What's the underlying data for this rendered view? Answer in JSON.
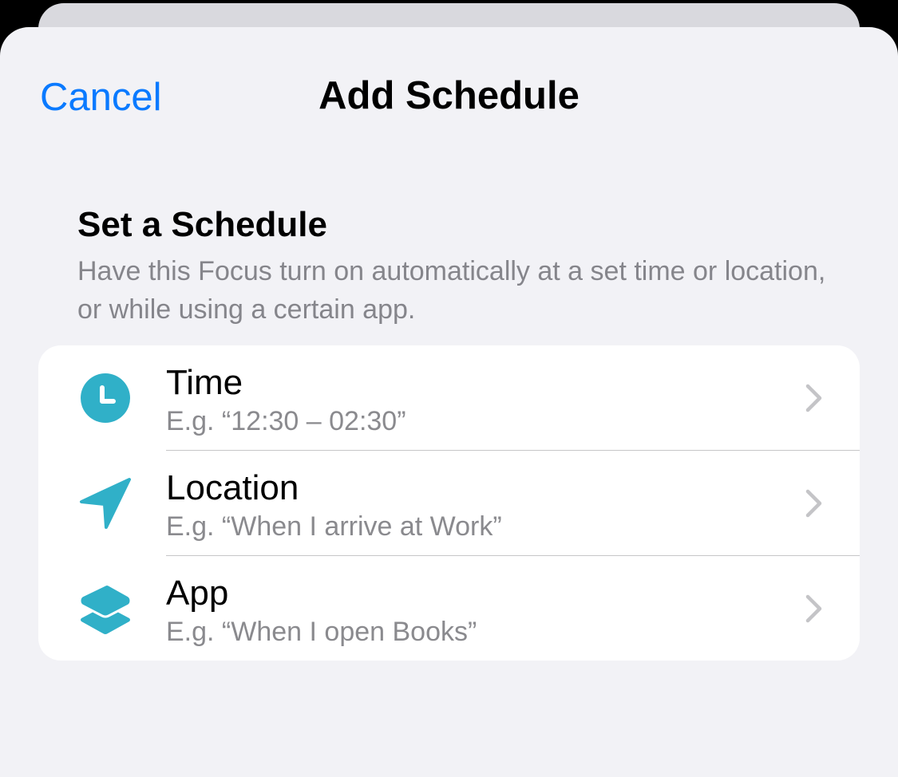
{
  "nav": {
    "cancel_label": "Cancel",
    "title": "Add Schedule"
  },
  "section": {
    "title": "Set a Schedule",
    "description": "Have this Focus turn on automatically at a set time or location, or while using a certain app."
  },
  "options": [
    {
      "label": "Time",
      "example": "E.g. “12:30 – 02:30”",
      "icon": "clock-icon"
    },
    {
      "label": "Location",
      "example": "E.g. “When I arrive at Work”",
      "icon": "location-arrow-icon"
    },
    {
      "label": "App",
      "example": "E.g. “When I open Books”",
      "icon": "app-layers-icon"
    }
  ],
  "colors": {
    "accent": "#0a7aff",
    "icon": "#30b0c8",
    "background": "#f2f2f6",
    "secondary_text": "#8a8a8e",
    "chevron": "#c4c4c7"
  }
}
